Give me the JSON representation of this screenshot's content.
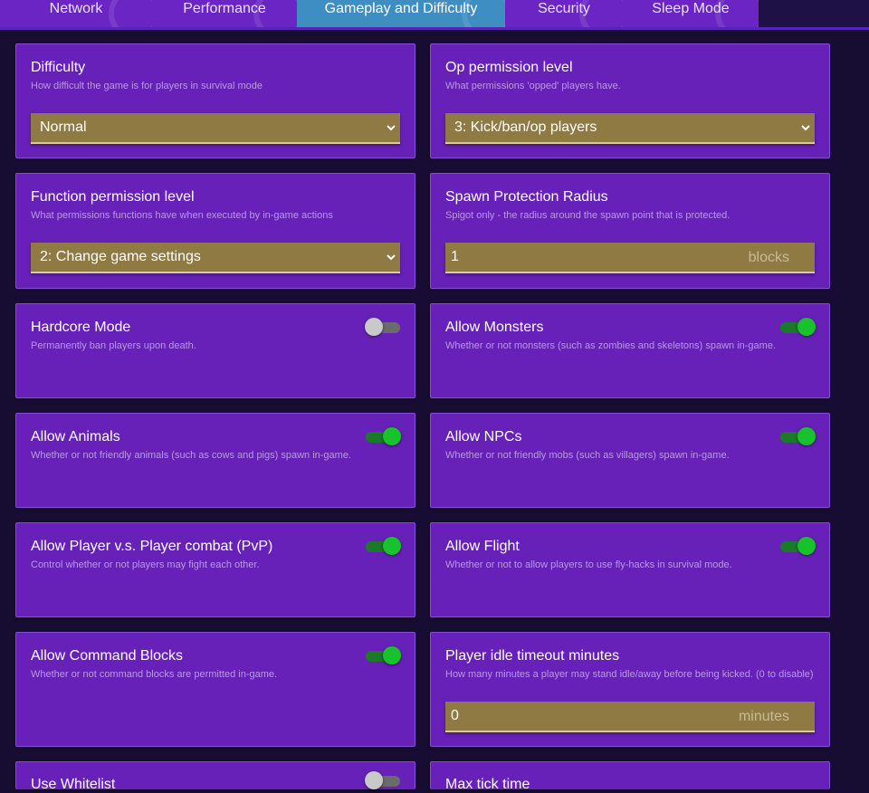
{
  "tabs": [
    {
      "label": "Network",
      "active": false
    },
    {
      "label": "Performance",
      "active": false
    },
    {
      "label": "Gameplay and Difficulty",
      "active": true
    },
    {
      "label": "Security",
      "active": false
    },
    {
      "label": "Sleep Mode",
      "active": false
    }
  ],
  "colors": {
    "background": "#170d33",
    "card": "#6721b8",
    "active_tab": "#3e8ec4",
    "field": "#8f7a44",
    "toggle_on": "#18c22c",
    "toggle_off": "#c9c9c9"
  },
  "settings": {
    "difficulty": {
      "title": "Difficulty",
      "description": "How difficult the game is for players in survival mode",
      "value": "Normal"
    },
    "op_permission": {
      "title": "Op permission level",
      "description": "What permissions 'opped' players have.",
      "value": "3: Kick/ban/op players"
    },
    "function_permission": {
      "title": "Function permission level",
      "description": "What permissions functions have when executed by in-game actions",
      "value": "2: Change game settings"
    },
    "spawn_protection": {
      "title": "Spawn Protection Radius",
      "description": "Spigot only - the radius around the spawn point that is protected.",
      "value": "1",
      "unit": "blocks"
    },
    "hardcore": {
      "title": "Hardcore Mode",
      "description": "Permanently ban players upon death.",
      "enabled": false
    },
    "allow_monsters": {
      "title": "Allow Monsters",
      "description": "Whether or not monsters (such as zombies and skeletons) spawn in-game.",
      "enabled": true
    },
    "allow_animals": {
      "title": "Allow Animals",
      "description": "Whether or not friendly animals (such as cows and pigs) spawn in-game.",
      "enabled": true
    },
    "allow_npcs": {
      "title": "Allow NPCs",
      "description": "Whether or not friendly mobs (such as villagers) spawn in-game.",
      "enabled": true
    },
    "allow_pvp": {
      "title": "Allow Player v.s. Player combat (PvP)",
      "description": "Control whether or not players may fight each other.",
      "enabled": true
    },
    "allow_flight": {
      "title": "Allow Flight",
      "description": "Whether or not to allow players to use fly-hacks in survival mode.",
      "enabled": true
    },
    "allow_command_blocks": {
      "title": "Allow Command Blocks",
      "description": "Whether or not command blocks are permitted in-game.",
      "enabled": true
    },
    "idle_timeout": {
      "title": "Player idle timeout minutes",
      "description": "How many minutes a player may stand idle/away before being kicked. (0 to disable)",
      "value": "0",
      "unit": "minutes"
    },
    "whitelist": {
      "title": "Use Whitelist",
      "enabled": false
    },
    "max_tick_time": {
      "title": "Max tick time"
    }
  }
}
